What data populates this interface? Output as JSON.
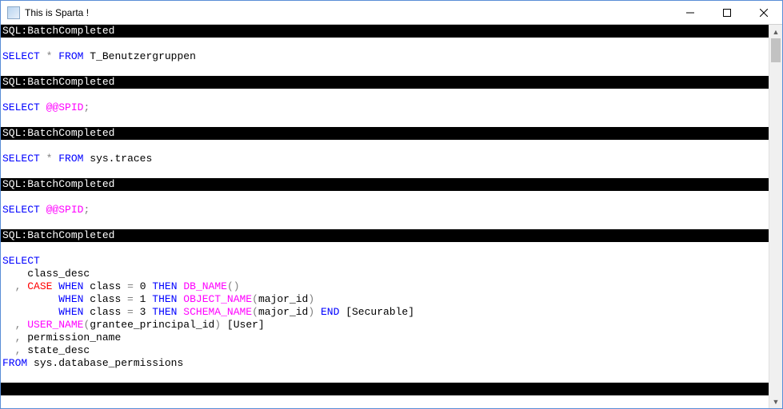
{
  "window": {
    "title": "This is Sparta !"
  },
  "events": [
    {
      "header": "SQL:BatchCompleted",
      "lines": [
        [
          {
            "cls": "kw-blue",
            "t": "SELECT"
          },
          {
            "cls": "plain",
            "t": " "
          },
          {
            "cls": "gray",
            "t": "*"
          },
          {
            "cls": "plain",
            "t": " "
          },
          {
            "cls": "kw-blue",
            "t": "FROM"
          },
          {
            "cls": "plain",
            "t": " T_Benutzergruppen"
          }
        ]
      ]
    },
    {
      "header": "SQL:BatchCompleted",
      "lines": [
        [
          {
            "cls": "kw-blue",
            "t": "SELECT"
          },
          {
            "cls": "plain",
            "t": " "
          },
          {
            "cls": "kw-magenta",
            "t": "@@SPID"
          },
          {
            "cls": "gray",
            "t": ";"
          }
        ]
      ]
    },
    {
      "header": "SQL:BatchCompleted",
      "lines": [
        [
          {
            "cls": "kw-blue",
            "t": "SELECT"
          },
          {
            "cls": "plain",
            "t": " "
          },
          {
            "cls": "gray",
            "t": "*"
          },
          {
            "cls": "plain",
            "t": " "
          },
          {
            "cls": "kw-blue",
            "t": "FROM"
          },
          {
            "cls": "plain",
            "t": " sys.traces"
          }
        ]
      ]
    },
    {
      "header": "SQL:BatchCompleted",
      "lines": [
        [
          {
            "cls": "kw-blue",
            "t": "SELECT"
          },
          {
            "cls": "plain",
            "t": " "
          },
          {
            "cls": "kw-magenta",
            "t": "@@SPID"
          },
          {
            "cls": "gray",
            "t": ";"
          }
        ]
      ]
    },
    {
      "header": "SQL:BatchCompleted",
      "lines": [
        [
          {
            "cls": "kw-blue",
            "t": "SELECT"
          }
        ],
        [
          {
            "cls": "plain",
            "t": "    class_desc "
          }
        ],
        [
          {
            "cls": "plain",
            "t": "  "
          },
          {
            "cls": "gray",
            "t": ","
          },
          {
            "cls": "plain",
            "t": " "
          },
          {
            "cls": "kw-red",
            "t": "CASE"
          },
          {
            "cls": "plain",
            "t": " "
          },
          {
            "cls": "kw-blue",
            "t": "WHEN"
          },
          {
            "cls": "plain",
            "t": " class "
          },
          {
            "cls": "gray",
            "t": "="
          },
          {
            "cls": "plain",
            "t": " 0 "
          },
          {
            "cls": "kw-blue",
            "t": "THEN"
          },
          {
            "cls": "plain",
            "t": " "
          },
          {
            "cls": "kw-magenta",
            "t": "DB_NAME"
          },
          {
            "cls": "gray",
            "t": "()"
          }
        ],
        [
          {
            "cls": "plain",
            "t": "         "
          },
          {
            "cls": "kw-blue",
            "t": "WHEN"
          },
          {
            "cls": "plain",
            "t": " class "
          },
          {
            "cls": "gray",
            "t": "="
          },
          {
            "cls": "plain",
            "t": " 1 "
          },
          {
            "cls": "kw-blue",
            "t": "THEN"
          },
          {
            "cls": "plain",
            "t": " "
          },
          {
            "cls": "kw-magenta",
            "t": "OBJECT_NAME"
          },
          {
            "cls": "gray",
            "t": "("
          },
          {
            "cls": "plain",
            "t": "major_id"
          },
          {
            "cls": "gray",
            "t": ")"
          }
        ],
        [
          {
            "cls": "plain",
            "t": "         "
          },
          {
            "cls": "kw-blue",
            "t": "WHEN"
          },
          {
            "cls": "plain",
            "t": " class "
          },
          {
            "cls": "gray",
            "t": "="
          },
          {
            "cls": "plain",
            "t": " 3 "
          },
          {
            "cls": "kw-blue",
            "t": "THEN"
          },
          {
            "cls": "plain",
            "t": " "
          },
          {
            "cls": "kw-magenta",
            "t": "SCHEMA_NAME"
          },
          {
            "cls": "gray",
            "t": "("
          },
          {
            "cls": "plain",
            "t": "major_id"
          },
          {
            "cls": "gray",
            "t": ")"
          },
          {
            "cls": "plain",
            "t": " "
          },
          {
            "cls": "kw-blue",
            "t": "END"
          },
          {
            "cls": "plain",
            "t": " [Securable]"
          }
        ],
        [
          {
            "cls": "plain",
            "t": "  "
          },
          {
            "cls": "gray",
            "t": ","
          },
          {
            "cls": "plain",
            "t": " "
          },
          {
            "cls": "kw-magenta",
            "t": "USER_NAME"
          },
          {
            "cls": "gray",
            "t": "("
          },
          {
            "cls": "plain",
            "t": "grantee_principal_id"
          },
          {
            "cls": "gray",
            "t": ")"
          },
          {
            "cls": "plain",
            "t": " [User]"
          }
        ],
        [
          {
            "cls": "plain",
            "t": "  "
          },
          {
            "cls": "gray",
            "t": ","
          },
          {
            "cls": "plain",
            "t": " permission_name"
          }
        ],
        [
          {
            "cls": "plain",
            "t": "  "
          },
          {
            "cls": "gray",
            "t": ","
          },
          {
            "cls": "plain",
            "t": " state_desc "
          }
        ],
        [
          {
            "cls": "kw-blue",
            "t": "FROM"
          },
          {
            "cls": "plain",
            "t": " sys.database_permissions"
          }
        ]
      ]
    },
    {
      "header": "",
      "lines": []
    }
  ]
}
